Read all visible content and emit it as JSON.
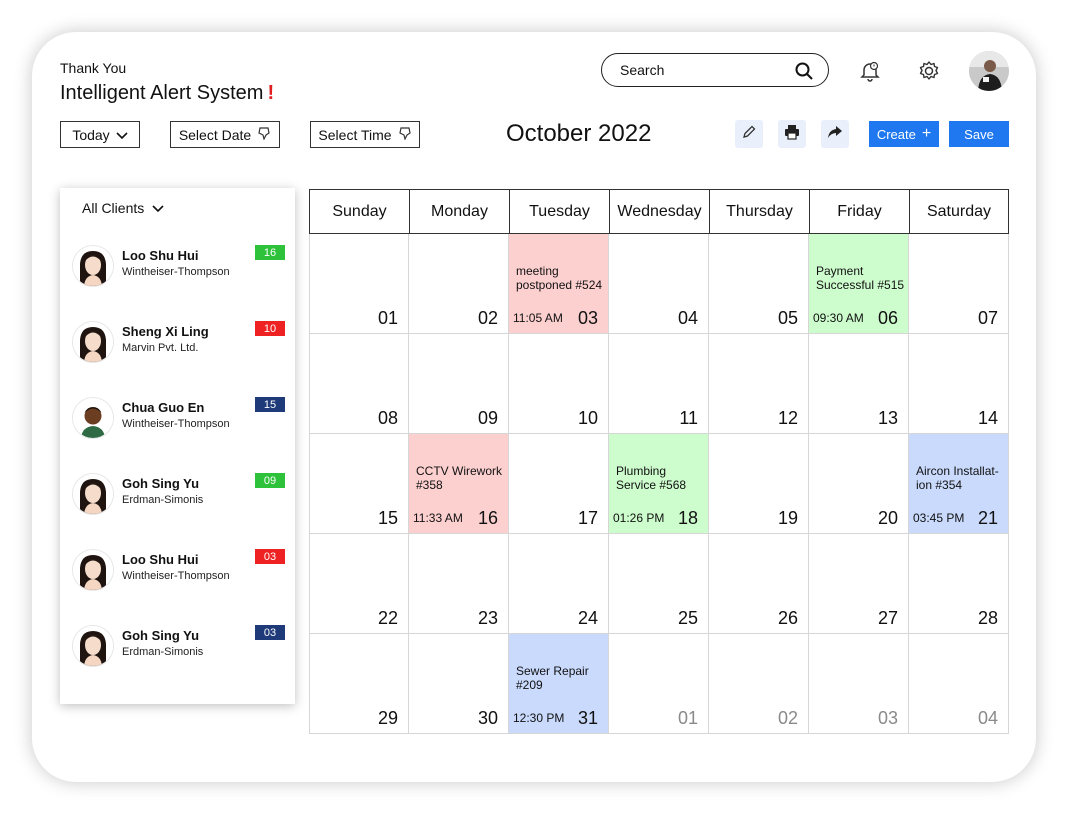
{
  "header": {
    "greeting": "Thank You",
    "title": "Intelligent Alert System",
    "title_mark": "!"
  },
  "search": {
    "placeholder": "Search"
  },
  "icons": {
    "search": "search-icon",
    "notifications": "bell-icon",
    "settings": "gear-icon",
    "edit": "pencil-icon",
    "print": "printer-icon",
    "share": "share-arrow-icon",
    "dropdown": "chevron-down-icon",
    "filter": "pin-icon"
  },
  "toolbar": {
    "today_label": "Today",
    "select_date_label": "Select Date",
    "select_time_label": "Select Time",
    "month_label": "October 2022",
    "create_label": "Create",
    "create_plus": "+",
    "save_label": "Save"
  },
  "sidebar": {
    "filter_label": "All Clients",
    "clients": [
      {
        "name": "Loo Shu Hui",
        "org": "Wintheiser-Thompson",
        "count": "16",
        "badge_color": "#2ec13a"
      },
      {
        "name": "Sheng Xi Ling",
        "org": "Marvin Pvt. Ltd.",
        "count": "10",
        "badge_color": "#ee2222"
      },
      {
        "name": "Chua Guo En",
        "org": "Wintheiser-Thompson",
        "count": "15",
        "badge_color": "#1e3a78"
      },
      {
        "name": "Goh Sing Yu",
        "org": "Erdman-Simonis",
        "count": "09",
        "badge_color": "#2ec13a"
      },
      {
        "name": "Loo Shu Hui",
        "org": "Wintheiser-Thompson",
        "count": "03",
        "badge_color": "#ee2222"
      },
      {
        "name": "Goh Sing Yu",
        "org": "Erdman-Simonis",
        "count": "03",
        "badge_color": "#1e3a78"
      }
    ]
  },
  "calendar": {
    "days": [
      "Sunday",
      "Monday",
      "Tuesday",
      "Wednesday",
      "Thursday",
      "Friday",
      "Saturday"
    ],
    "weeks": [
      [
        {
          "d": "01"
        },
        {
          "d": "02"
        },
        {
          "d": "03",
          "ev": "meeting postponed #524",
          "time": "11:05 AM",
          "color": "red"
        },
        {
          "d": "04"
        },
        {
          "d": "05"
        },
        {
          "d": "06",
          "ev": "Payment Successful #515",
          "time": "09:30 AM",
          "color": "green"
        },
        {
          "d": "07"
        }
      ],
      [
        {
          "d": "08"
        },
        {
          "d": "09"
        },
        {
          "d": "10"
        },
        {
          "d": "11"
        },
        {
          "d": "12"
        },
        {
          "d": "13"
        },
        {
          "d": "14"
        }
      ],
      [
        {
          "d": "15"
        },
        {
          "d": "16",
          "ev": "CCTV Wirework #358",
          "time": "11:33 AM",
          "color": "red"
        },
        {
          "d": "17"
        },
        {
          "d": "18",
          "ev": "Plumbing Service #568",
          "time": "01:26 PM",
          "color": "green"
        },
        {
          "d": "19"
        },
        {
          "d": "20"
        },
        {
          "d": "21",
          "ev": "Aircon Installat-ion #354",
          "time": "03:45 PM",
          "color": "blue"
        }
      ],
      [
        {
          "d": "22"
        },
        {
          "d": "23"
        },
        {
          "d": "24"
        },
        {
          "d": "25"
        },
        {
          "d": "26"
        },
        {
          "d": "27"
        },
        {
          "d": "28"
        }
      ],
      [
        {
          "d": "29"
        },
        {
          "d": "30"
        },
        {
          "d": "31",
          "ev": "Sewer Repair #209",
          "time": "12:30 PM",
          "color": "blue"
        },
        {
          "d": "01",
          "dim": true
        },
        {
          "d": "02",
          "dim": true
        },
        {
          "d": "03",
          "dim": true
        },
        {
          "d": "04",
          "dim": true
        }
      ]
    ]
  }
}
